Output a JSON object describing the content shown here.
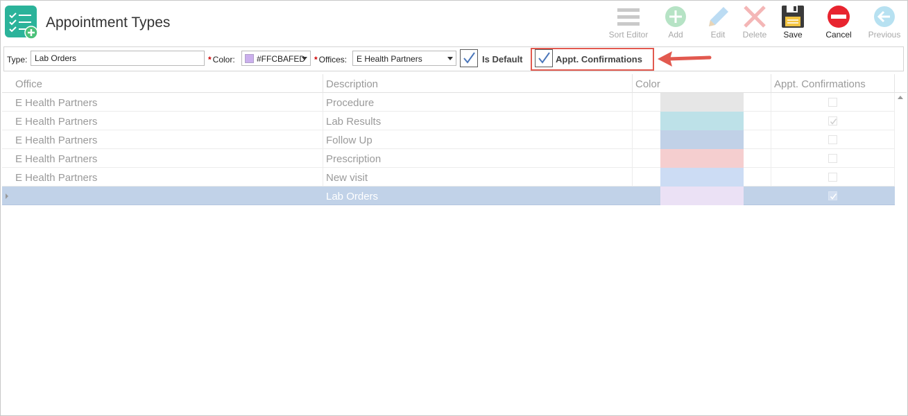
{
  "header": {
    "title": "Appointment Types"
  },
  "toolbar": {
    "sort_editor": "Sort Editor",
    "add": "Add",
    "edit": "Edit",
    "delete": "Delete",
    "save": "Save",
    "cancel": "Cancel",
    "previous": "Previous"
  },
  "form": {
    "type_label": "Type:",
    "type_value": "Lab Orders",
    "color_label": "Color:",
    "color_value": "#FFCBAFED",
    "offices_label": "Offices:",
    "offices_value": "E Health Partners",
    "is_default_label": "Is Default",
    "appt_confirmations_label": "Appt. Confirmations",
    "required_marker": "*"
  },
  "grid": {
    "columns": [
      "Office",
      "Description",
      "Color",
      "Appt. Confirmations"
    ],
    "rows": [
      {
        "office": "E Health Partners",
        "description": "Procedure",
        "color": "#e6e6e6",
        "confirm": false
      },
      {
        "office": "E Health Partners",
        "description": "Lab Results",
        "color": "#bde1e8",
        "confirm": true
      },
      {
        "office": "E Health Partners",
        "description": "Follow Up",
        "color": "#c1d1e7",
        "confirm": false
      },
      {
        "office": "E Health Partners",
        "description": "Prescription",
        "color": "#f5cecf",
        "confirm": false
      },
      {
        "office": "E Health Partners",
        "description": "New visit",
        "color": "#ccdcf4",
        "confirm": false
      },
      {
        "office": "",
        "description": "Lab Orders",
        "color": "#ebe1f5",
        "confirm": true,
        "selected": true
      }
    ]
  },
  "colors": {
    "accent": "#2bb39a",
    "highlight": "#e2594f",
    "selected_row": "#c1d2e8"
  }
}
